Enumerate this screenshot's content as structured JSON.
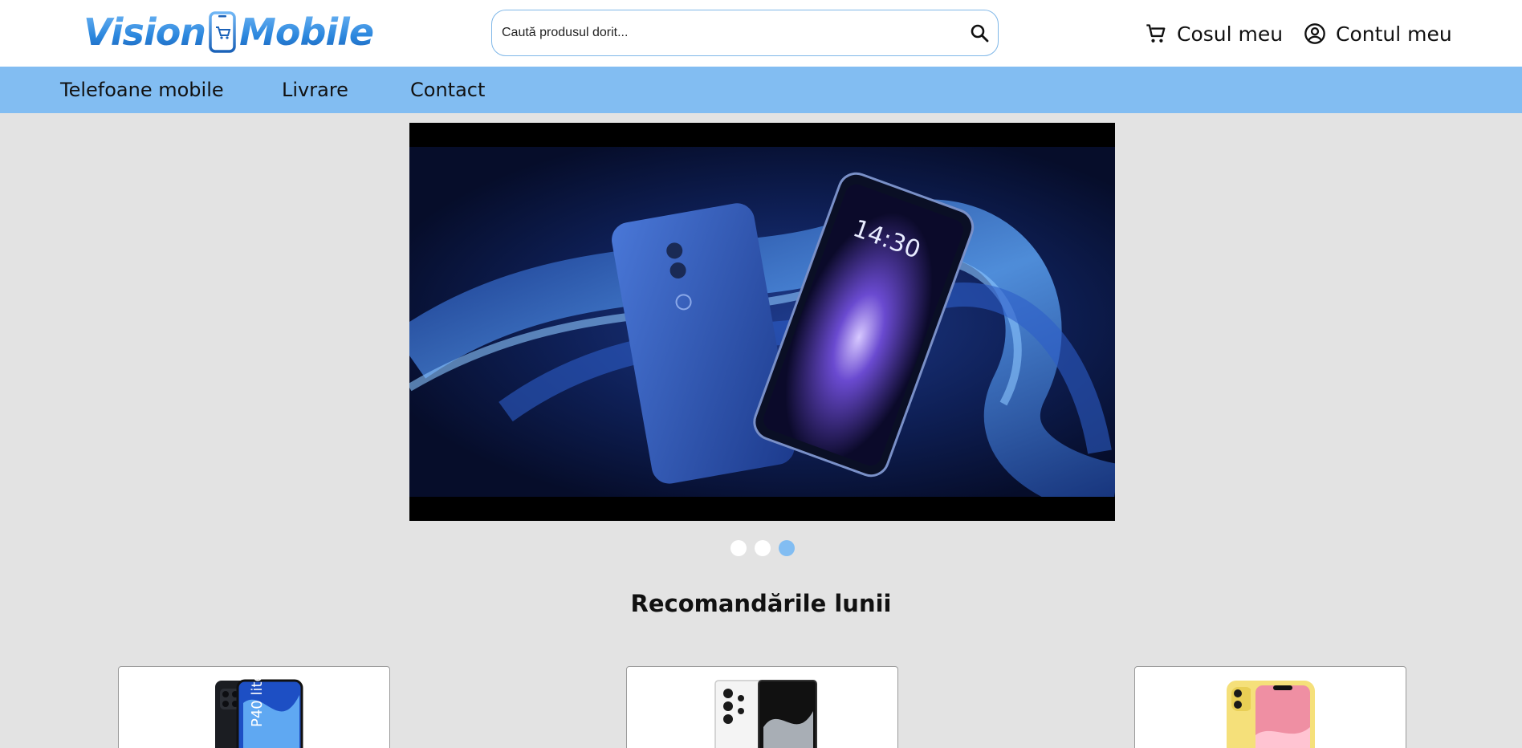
{
  "header": {
    "logo": {
      "word1": "Vision",
      "word2": "Mobile"
    },
    "search": {
      "placeholder": "Caută produsul dorit...",
      "icon": "search-icon"
    },
    "cart": {
      "label": "Cosul meu",
      "icon": "cart-icon"
    },
    "account": {
      "label": "Contul meu",
      "icon": "account-circle-icon"
    }
  },
  "nav": {
    "items": [
      {
        "label": "Telefoane mobile"
      },
      {
        "label": "Livrare"
      },
      {
        "label": "Contact"
      }
    ]
  },
  "carousel": {
    "slide_count": 3,
    "active_index": 3,
    "slide_clock": "14:30"
  },
  "recommendations": {
    "title": "Recomandările lunii",
    "products": [
      {
        "image": "huawei-p40-lite",
        "image_text": "P40 lite"
      },
      {
        "image": "samsung-galaxy-s22-ultra"
      },
      {
        "image": "iphone-11-yellow"
      }
    ]
  },
  "colors": {
    "accent": "#82bdf2",
    "background": "#e3e3e3",
    "logo_blue": "#2a86dd"
  }
}
